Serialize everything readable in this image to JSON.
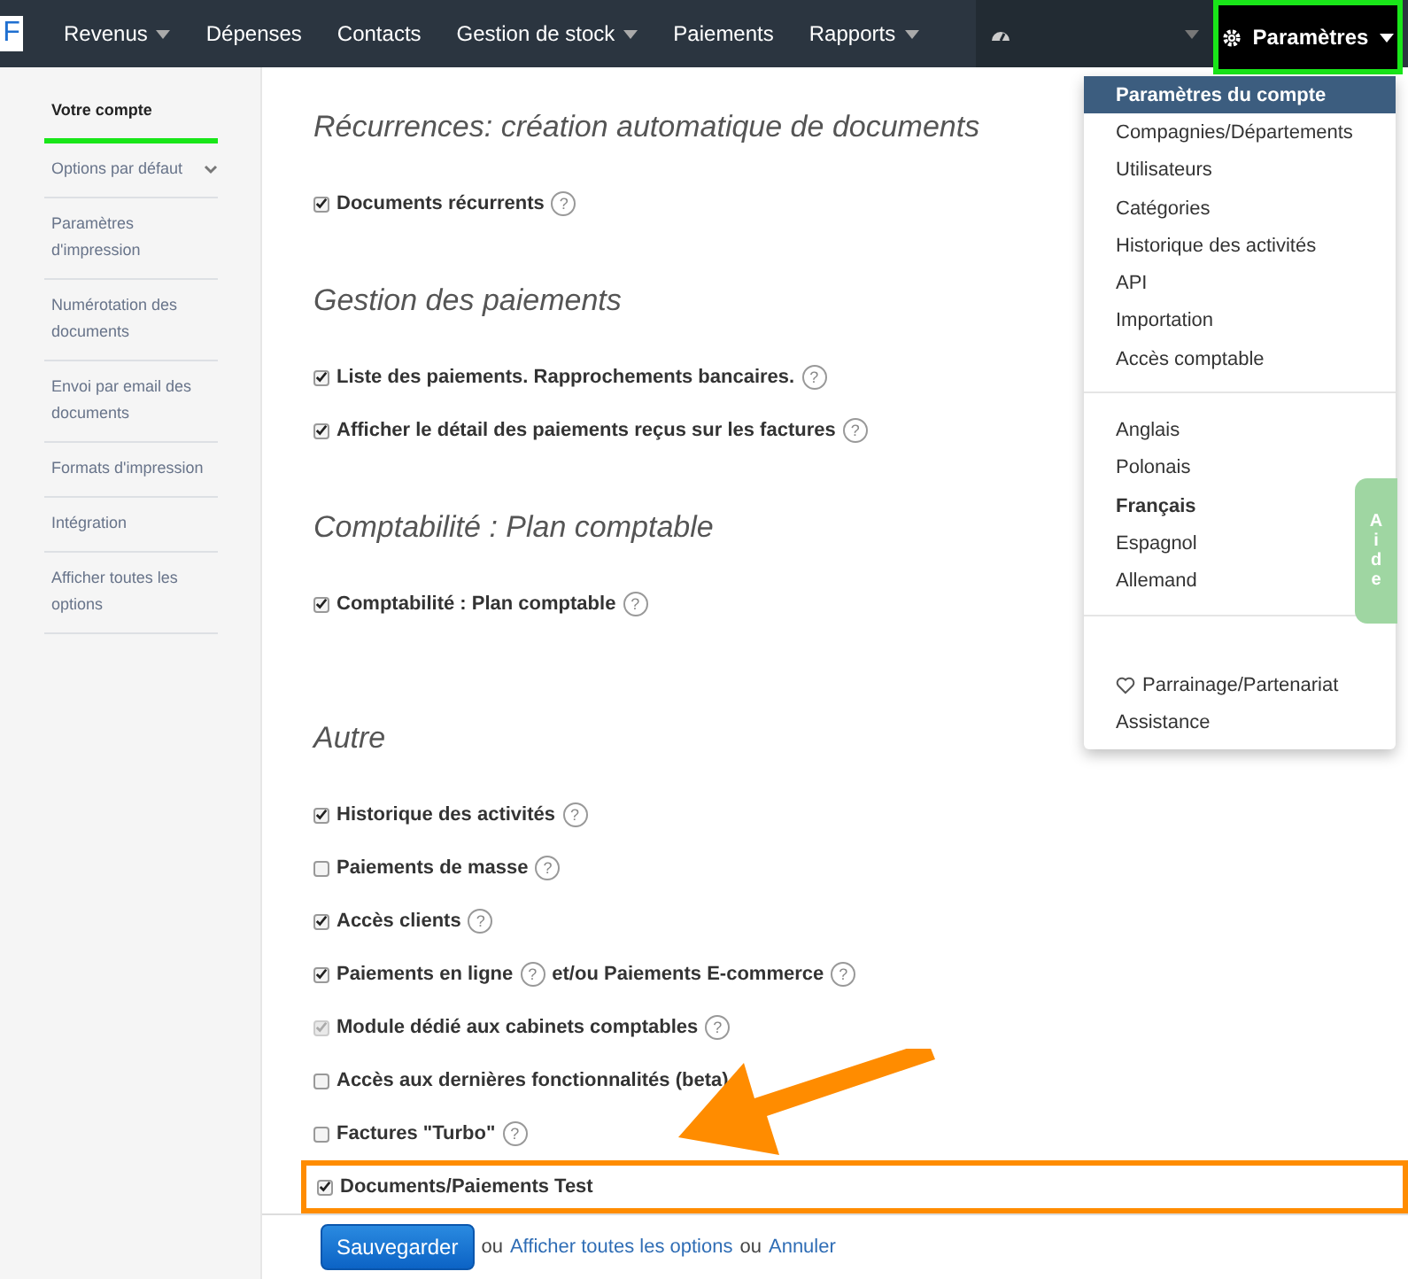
{
  "nav": {
    "logo": "F",
    "items": [
      {
        "label": "Revenus",
        "caret": true
      },
      {
        "label": "Dépenses",
        "caret": false
      },
      {
        "label": "Contacts",
        "caret": false
      },
      {
        "label": "Gestion de stock",
        "caret": true
      },
      {
        "label": "Paiements",
        "caret": false
      },
      {
        "label": "Rapports",
        "caret": true
      }
    ],
    "settings": {
      "label": "Paramètres",
      "highlighted": true
    }
  },
  "sidebar": {
    "items": [
      {
        "label": "Votre compte",
        "selected": true,
        "expandable": false
      },
      {
        "label": "Options par défaut",
        "selected": false,
        "expandable": true
      },
      {
        "label": "Paramètres d'impression",
        "selected": false,
        "expandable": false
      },
      {
        "label": "Numérotation des documents",
        "selected": false,
        "expandable": false
      },
      {
        "label": "Envoi par email des documents",
        "selected": false,
        "expandable": false
      },
      {
        "label": "Formats d'impression",
        "selected": false,
        "expandable": false
      },
      {
        "label": "Intégration",
        "selected": false,
        "expandable": false
      },
      {
        "label": "Afficher toutes les options",
        "selected": false,
        "expandable": false
      }
    ]
  },
  "sections": [
    {
      "title": "Récurrences: création automatique de documents",
      "options": [
        {
          "label": "Documents récurrents",
          "checked": true,
          "disabled": false,
          "help": "?"
        }
      ]
    },
    {
      "title": "Gestion des paiements",
      "options": [
        {
          "label": "Liste des paiements. Rapprochements bancaires.",
          "checked": true,
          "disabled": false,
          "help": "?"
        },
        {
          "label": "Afficher le détail des paiements reçus sur les factures",
          "checked": true,
          "disabled": false,
          "help": "?"
        }
      ]
    },
    {
      "title": "Comptabilité : Plan comptable",
      "options": [
        {
          "label": "Comptabilité : Plan comptable",
          "checked": true,
          "disabled": false,
          "help": "?"
        }
      ]
    },
    {
      "title": "Autre",
      "options": [
        {
          "label": "Historique des activités",
          "checked": true,
          "disabled": false,
          "help": "?"
        },
        {
          "label": "Paiements de masse",
          "checked": false,
          "disabled": false,
          "help": "?"
        },
        {
          "label": "Accès clients",
          "checked": true,
          "disabled": false,
          "help": "?"
        },
        {
          "label": "Paiements en ligne",
          "checked": true,
          "disabled": false,
          "help": "?",
          "suffix": "et/ou Paiements E-commerce",
          "suffix_help": "?"
        },
        {
          "label": "Module dédié aux cabinets comptables",
          "checked": true,
          "disabled": true,
          "help": "?"
        },
        {
          "label": "Accès aux dernières fonctionnalités (beta)",
          "checked": false,
          "disabled": false
        },
        {
          "label": "Factures \"Turbo\"",
          "checked": false,
          "disabled": false,
          "help": "?"
        },
        {
          "label": "Documents/Paiements Test",
          "checked": true,
          "disabled": false,
          "highlighted": true
        }
      ]
    }
  ],
  "footer": {
    "save": "Sauvegarder",
    "or_1": "ou",
    "link_all": "Afficher toutes les options",
    "or_2": "ou",
    "cancel": "Annuler"
  },
  "dropdown": {
    "groups": [
      [
        {
          "label": "Paramètres du compte",
          "selected": true,
          "bold": false
        },
        {
          "label": "Compagnies/Départements",
          "selected": false,
          "bold": false
        },
        {
          "label": "Utilisateurs",
          "selected": false,
          "bold": false
        },
        {
          "label": "Catégories",
          "selected": false,
          "bold": false
        },
        {
          "label": "Historique des activités",
          "selected": false,
          "bold": false
        },
        {
          "label": "API",
          "selected": false,
          "bold": false
        },
        {
          "label": "Importation",
          "selected": false,
          "bold": false
        },
        {
          "label": "Accès comptable",
          "selected": false,
          "bold": false
        }
      ],
      [
        {
          "label": "Anglais",
          "selected": false,
          "bold": false
        },
        {
          "label": "Polonais",
          "selected": false,
          "bold": false
        },
        {
          "label": "Français",
          "selected": false,
          "bold": true
        },
        {
          "label": "Espagnol",
          "selected": false,
          "bold": false
        },
        {
          "label": "Allemand",
          "selected": false,
          "bold": false
        }
      ],
      [
        {
          "label": "Parrainage/Partenariat",
          "selected": false,
          "bold": false
        },
        {
          "label": "Assistance",
          "selected": false,
          "bold": false
        }
      ]
    ]
  },
  "help_tab": "Aide"
}
